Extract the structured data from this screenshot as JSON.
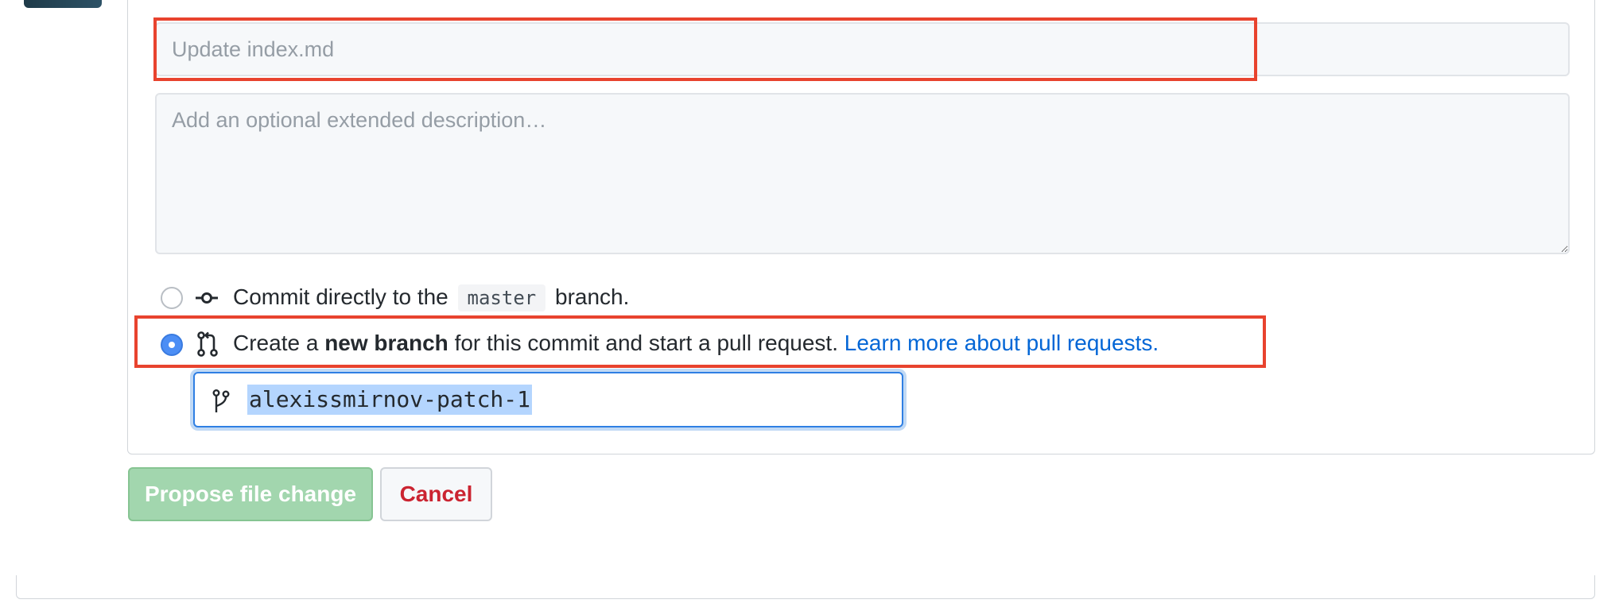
{
  "commit_form": {
    "summary_placeholder": "Update index.md",
    "summary_value": "",
    "description_placeholder": "Add an optional extended description…",
    "description_value": ""
  },
  "options": {
    "direct": {
      "selected": false,
      "icon": "git-commit-icon",
      "text_before": "Commit directly to the",
      "branch": "master",
      "text_after": "branch."
    },
    "new_branch": {
      "selected": true,
      "icon": "git-pull-request-icon",
      "text_before": "Create a",
      "bold_text": "new branch",
      "text_after": "for this commit and start a pull request.",
      "link_text": "Learn more about pull requests."
    }
  },
  "branch_name": {
    "icon": "git-branch-icon",
    "value": "alexissmirnov-patch-1"
  },
  "actions": {
    "propose_label": "Propose file change",
    "cancel_label": "Cancel"
  },
  "colors": {
    "highlight": "#e8432e",
    "link": "#0366d6",
    "primary_disabled": "#a2d6ae",
    "cancel_text": "#cb2431",
    "radio_selected": "#4c8ef5"
  }
}
